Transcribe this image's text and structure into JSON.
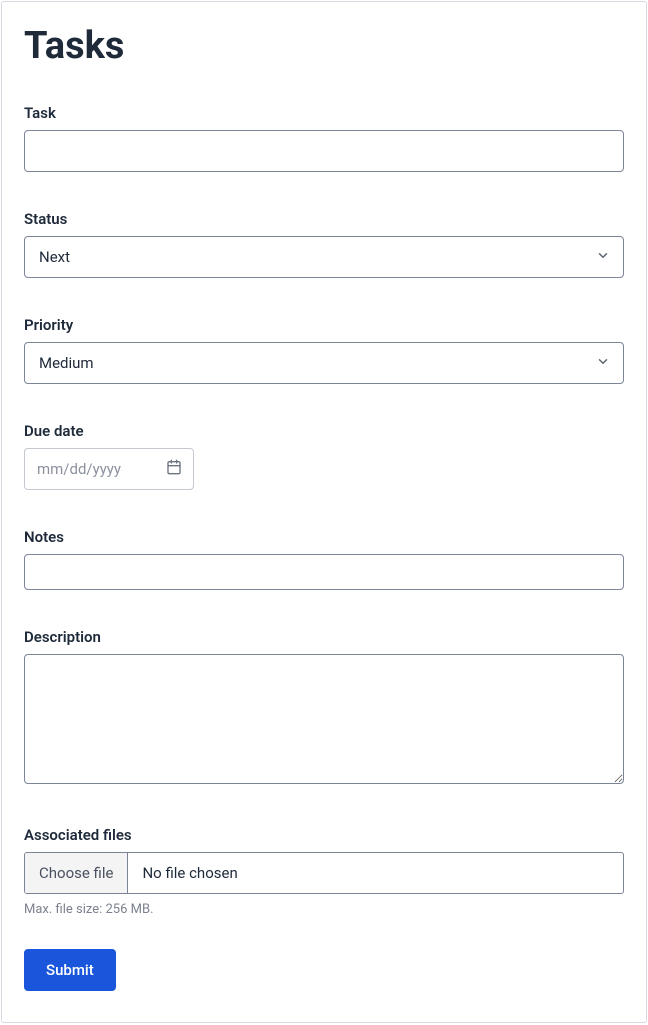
{
  "page": {
    "title": "Tasks"
  },
  "form": {
    "task": {
      "label": "Task",
      "value": ""
    },
    "status": {
      "label": "Status",
      "selected": "Next"
    },
    "priority": {
      "label": "Priority",
      "selected": "Medium"
    },
    "due_date": {
      "label": "Due date",
      "placeholder": "mm/dd/yyyy",
      "value": ""
    },
    "notes": {
      "label": "Notes",
      "value": ""
    },
    "description": {
      "label": "Description",
      "value": ""
    },
    "files": {
      "label": "Associated files",
      "button": "Choose file",
      "no_file": "No file chosen",
      "hint": "Max. file size: 256 MB."
    },
    "submit_label": "Submit"
  }
}
